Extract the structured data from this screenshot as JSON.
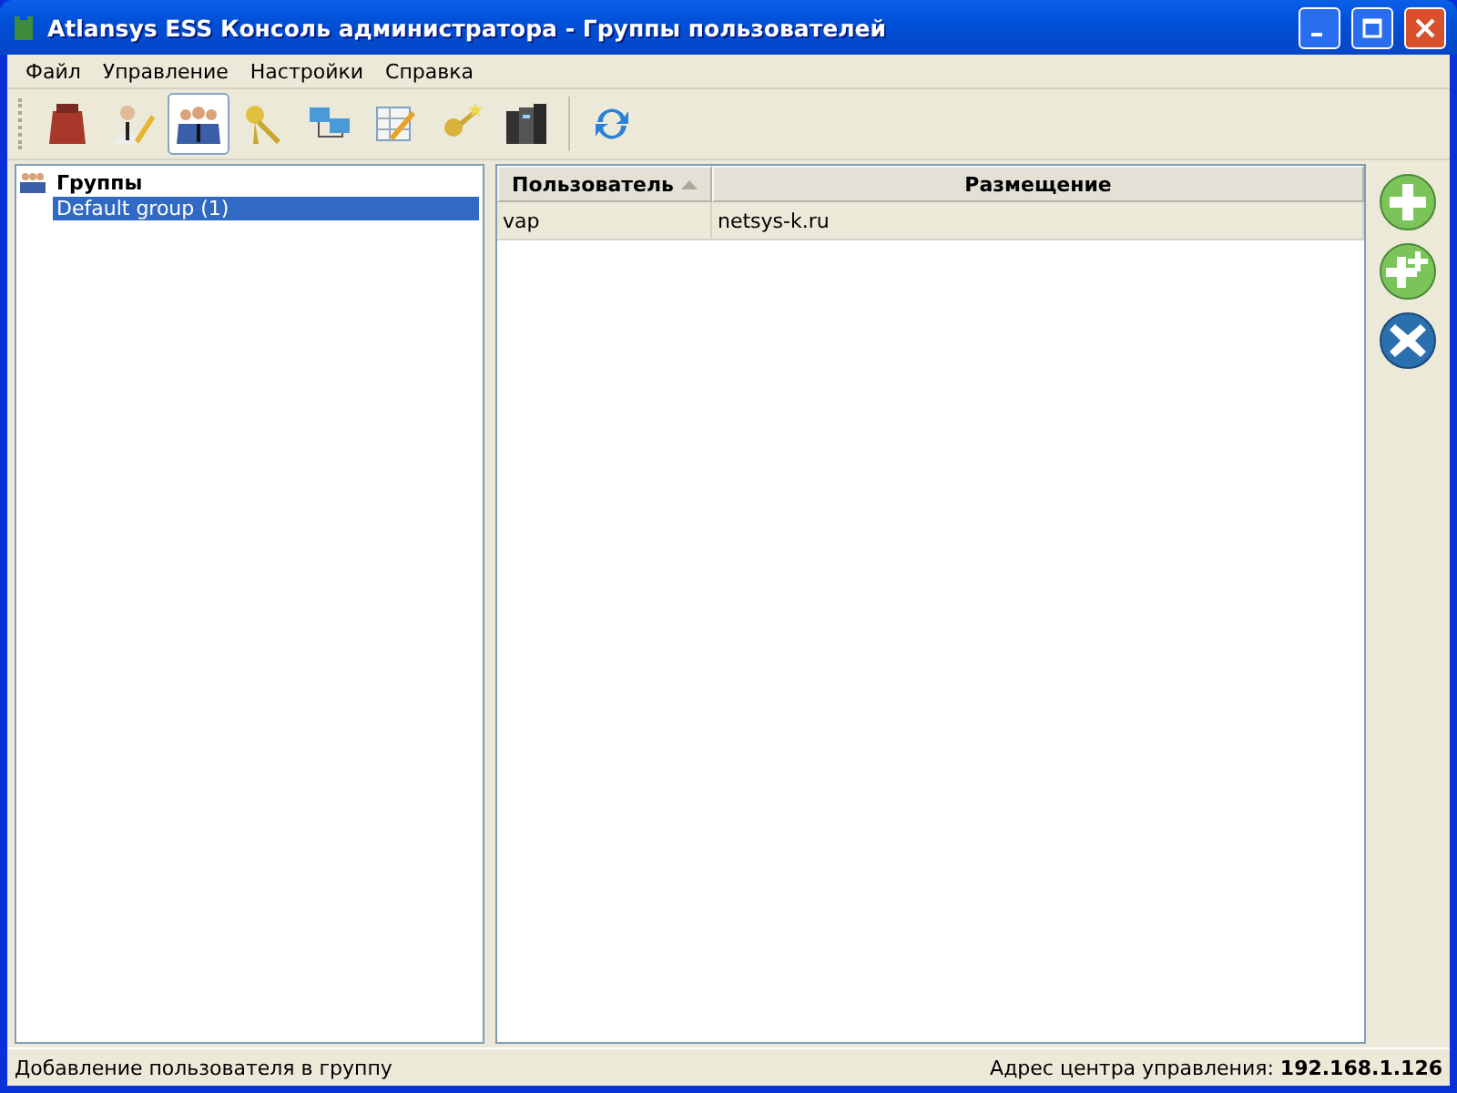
{
  "window": {
    "title": "Atlansys ESS Консоль администратора - Группы пользователей"
  },
  "menu": [
    "Файл",
    "Управление",
    "Настройки",
    "Справка"
  ],
  "toolbar": [
    {
      "kind": "bag",
      "selected": false
    },
    {
      "kind": "user-edit",
      "selected": false
    },
    {
      "kind": "users",
      "selected": true
    },
    {
      "kind": "keys",
      "selected": false
    },
    {
      "kind": "network",
      "selected": false
    },
    {
      "kind": "table-edit",
      "selected": false
    },
    {
      "kind": "key-star",
      "selected": false
    },
    {
      "kind": "servers",
      "selected": false
    },
    {
      "kind": "refresh",
      "selected": false
    }
  ],
  "tree": {
    "label": "Группы",
    "children": [
      {
        "label": "Default group (1)",
        "selected": true
      }
    ]
  },
  "table": {
    "columns": [
      {
        "label": "Пользователь",
        "sorted": true
      },
      {
        "label": "Размещение",
        "sorted": false
      }
    ],
    "rows": [
      {
        "cells": [
          "vap",
          "netsys-k.ru"
        ],
        "selected": true
      }
    ]
  },
  "side_buttons": [
    {
      "kind": "add"
    },
    {
      "kind": "add-many"
    },
    {
      "kind": "remove"
    }
  ],
  "status_bar": {
    "message": "Добавление пользователя в группу",
    "server": "Адрес центра управления: **192.168.1.126**"
  }
}
